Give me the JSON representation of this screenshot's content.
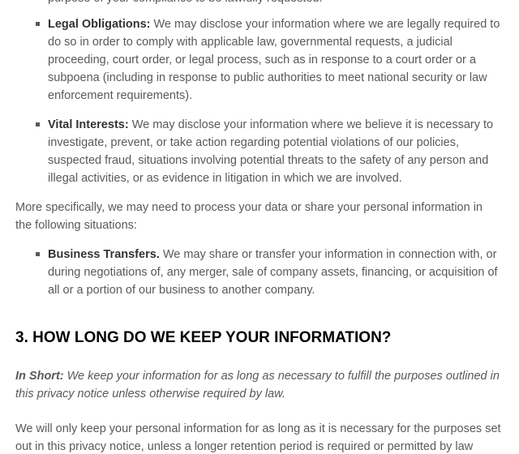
{
  "partial_top_line": "purpose of your compliance to be lawfully requested.",
  "legal_obligations": {
    "label": "Legal Obligations:",
    "text": " We may disclose your information where we are legally required to do so in order to comply with applicable law, governmental requests, a judicial proceeding, court order, or legal process, such as in response to a court order or a subpoena (including in response to public authorities to meet national security or law enforcement requirements)."
  },
  "vital_interests": {
    "label": "Vital Interests:",
    "text": " We may disclose your information where we believe it is necessary to investigate, prevent, or take action regarding potential violations of our policies, suspected fraud, situations involving potential threats to the safety of any person and illegal activities, or as evidence in litigation in which we are involved."
  },
  "more_specifically": "More specifically, we may need to process your data or share your personal information in the following situations:",
  "business_transfers": {
    "label": "Business Transfers.",
    "text": " We may share or transfer your information in connection with, or during negotiations of, any merger, sale of company assets, financing, or acquisition of all or a portion of our business to another company."
  },
  "section3": {
    "heading": "3. HOW LONG DO WE KEEP YOUR INFORMATION?",
    "in_short_label": "In Short:",
    "in_short_text": "  We keep your information for as long as necessary to fulfill the purposes outlined in this privacy notice unless otherwise required by law.",
    "body": "We will only keep your personal information for as long as it is necessary for the purposes set out in this privacy notice, unless a longer retention period is required or permitted by law (such"
  }
}
